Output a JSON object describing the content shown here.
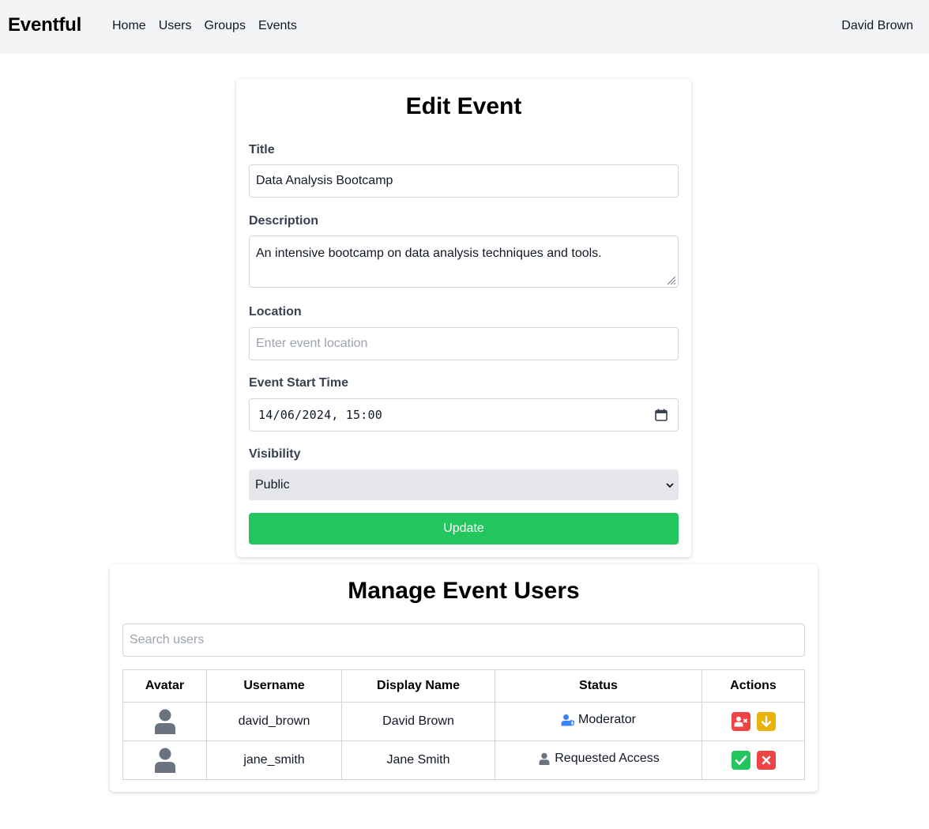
{
  "nav": {
    "brand": "Eventful",
    "links": [
      "Home",
      "Users",
      "Groups",
      "Events"
    ],
    "user": "David Brown"
  },
  "edit_event": {
    "title": "Edit Event",
    "fields": {
      "title_label": "Title",
      "title_value": "Data Analysis Bootcamp",
      "description_label": "Description",
      "description_value": "An intensive bootcamp on data analysis techniques and tools.",
      "location_label": "Location",
      "location_placeholder": "Enter event location",
      "start_label": "Event Start Time",
      "start_value": "14/06/2024, 15:00",
      "visibility_label": "Visibility",
      "visibility_value": "Public"
    },
    "update_label": "Update"
  },
  "manage_users": {
    "title": "Manage Event Users",
    "search_placeholder": "Search users",
    "headers": [
      "Avatar",
      "Username",
      "Display Name",
      "Status",
      "Actions"
    ],
    "rows": [
      {
        "username": "david_brown",
        "display_name": "David Brown",
        "status": "Moderator",
        "status_icon": "user-shield-icon",
        "actions": [
          "remove-moderator-icon",
          "demote-icon"
        ]
      },
      {
        "username": "jane_smith",
        "display_name": "Jane Smith",
        "status": "Requested Access",
        "status_icon": "user-icon",
        "actions": [
          "approve-icon",
          "reject-icon"
        ]
      }
    ]
  },
  "colors": {
    "nav_bg": "#f3f4f6",
    "primary_green": "#22c55e",
    "danger_red": "#ef4444",
    "warning_yellow": "#eab308",
    "moderator_blue": "#3b82f6",
    "avatar_gray": "#6b7280"
  }
}
